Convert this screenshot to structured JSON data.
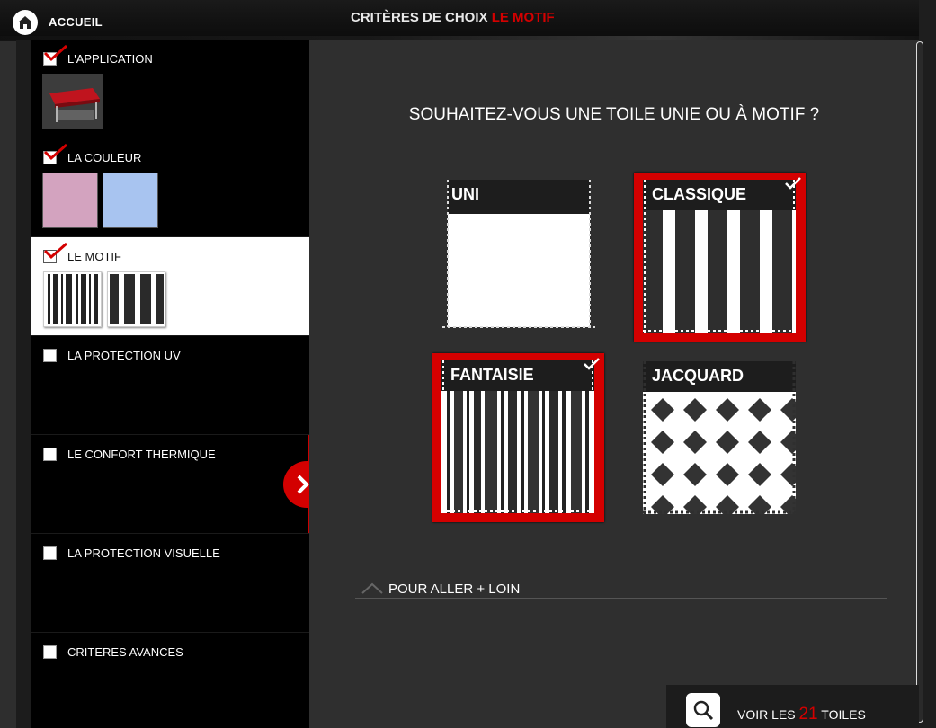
{
  "header": {
    "home_label": "ACCUEIL",
    "title_prefix": "CRITÈRES DE CHOIX",
    "title_accent": "LE MOTIF"
  },
  "sidebar": {
    "items": [
      {
        "label": "L'APPLICATION",
        "checked": true
      },
      {
        "label": "LA COULEUR",
        "checked": true
      },
      {
        "label": "LE MOTIF",
        "checked": true,
        "active": true
      },
      {
        "label": "LA PROTECTION UV",
        "checked": false
      },
      {
        "label": "LE CONFORT THERMIQUE",
        "checked": false
      },
      {
        "label": "LA PROTECTION VISUELLE",
        "checked": false
      },
      {
        "label": "CRITERES AVANCES",
        "checked": false
      }
    ],
    "color_swatches": [
      "#d3a3bf",
      "#a8c4f0"
    ]
  },
  "main": {
    "question": "SOUHAITEZ-VOUS UNE TOILE UNIE OU À MOTIF ?",
    "options": [
      {
        "label": "UNI",
        "selected": false
      },
      {
        "label": "CLASSIQUE",
        "selected": true
      },
      {
        "label": "FANTAISIE",
        "selected": true
      },
      {
        "label": "JACQUARD",
        "selected": false
      }
    ],
    "more_label": "POUR ALLER + LOIN"
  },
  "results": {
    "prefix": "VOIR LES",
    "count": "21",
    "suffix": "TOILES"
  },
  "colors": {
    "accent": "#d40000",
    "background": "#2f2f2f",
    "sidebar": "#000000"
  }
}
